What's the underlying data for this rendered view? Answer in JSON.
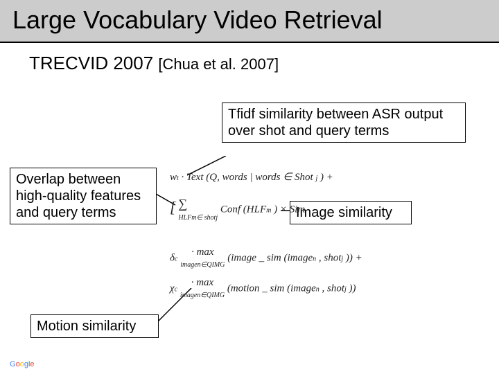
{
  "title": "Large Vocabulary Video Retrieval",
  "subtitle": {
    "main": "TRECVID 2007 ",
    "cite": "[Chua et al. 2007]"
  },
  "boxes": {
    "tfidf": "Tfidf similarity between ASR output over shot and query terms",
    "overlap": "Overlap between high-quality features and query terms",
    "image": "Image similarity",
    "motion": "Motion similarity"
  },
  "formula": {
    "line1_a": "w",
    "line1_b": "· Text (Q, words | words ∈ Shot",
    "line1_c": ") +",
    "line2_a": "∑",
    "line2_b": "Conf (HLF",
    "line2_c": ") × Sim",
    "line2_under": "HLF",
    "line2_under2": "∈ shot",
    "line3_a": "δ",
    "line3_b": "·   max",
    "line3_c": "(image _ sim (image",
    "line3_d": ", shot",
    "line3_e": ")) +",
    "line3_under": "image",
    "line3_under2": "∈Q",
    "line4_a": "χ",
    "line4_b": "·   max",
    "line4_c": "(motion _ sim (image",
    "line4_d": ", shot",
    "line4_e": "))",
    "line4_under": "image",
    "line4_under2": "∈Q",
    "sub_j": "j",
    "sub_m": "m",
    "sub_n": "n",
    "sub_c": "c",
    "sub_img": "IMG",
    "sub_t": "t"
  },
  "footer": "Google"
}
